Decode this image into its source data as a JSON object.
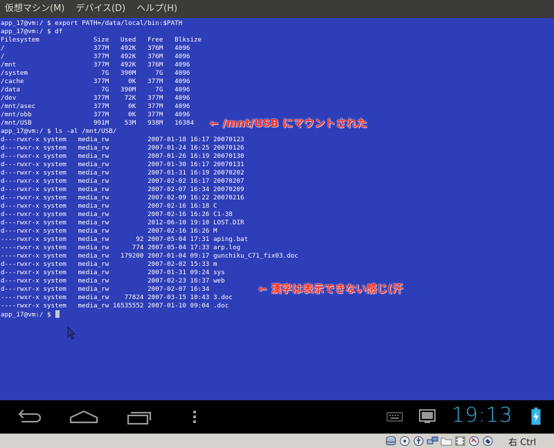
{
  "menubar": {
    "items": [
      "仮想マシン(M)",
      "デバイス(D)",
      "ヘルプ(H)"
    ]
  },
  "terminal": {
    "lines": [
      "app_17@vm:/ $ export PATH=/data/local/bin:$PATH",
      "app_17@vm:/ $ df",
      "Filesystem              Size   Used   Free   Blksize",
      "/                       377M   492K   376M   4096",
      "/                       377M   492K   376M   4096",
      "/mnt                    377M   492K   376M   4096",
      "/system                   7G   390M     7G   4096",
      "/cache                  377M     0K   377M   4096",
      "/data                     7G   390M     7G   4096",
      "/dev                    377M    72K   377M   4096",
      "/mnt/asec               377M     0K   377M   4096",
      "/mnt/obb                377M     0K   377M   4096",
      "/mnt/USB                991M    53M   938M   16384",
      "app_17@vm:/ $ ls -al /mnt/USB/",
      "d---rwxr-x system   media_rw          2007-01-18 16:17 20070123",
      "d---rwxr-x system   media_rw          2007-01-24 16:25 20070126",
      "d---rwxr-x system   media_rw          2007-01-26 16:19 20070130",
      "d---rwxr-x system   media_rw          2007-01-30 16:17 20070131",
      "d---rwxr-x system   media_rw          2007-01-31 16:19 20070202",
      "d---rwxr-x system   media_rw          2007-02-02 16:17 20070207",
      "d---rwxr-x system   media_rw          2007-02-07 16:34 20070209",
      "d---rwxr-x system   media_rw          2007-02-09 16:22 20070216",
      "d---rwxr-x system   media_rw          2007-02-16 16:18 C",
      "d---rwxr-x system   media_rw          2007-02-16 16:26 C1-38",
      "d---rwxr-x system   media_rw          2012-06-10 19:10 LOST.DIR",
      "d---rwxr-x system   media_rw          2007-02-16 16:26 M",
      "----rwxr-x system   media_rw       92 2007-05-04 17:31 aping.bat",
      "----rwxr-x system   media_rw      774 2007-05-04 17:33 arp.log",
      "----rwxr-x system   media_rw   179200 2007-01-04 09:17 gunchiku_C71_fix03.doc",
      "d---rwxr-x system   media_rw          2007-02-02 15:33 m",
      "d---rwxr-x system   media_rw          2007-01-31 09:24 sys",
      "d---rwxr-x system   media_rw          2007-02-23 16:37 web",
      "d---rwxr-x system   media_rw          2007-02-07 16:34",
      "----rwxr-x system   media_rw    77824 2007-03-15 10:43 3.doc",
      "----rwxr-x system   media_rw 16535552 2007-01-10 09:04 .doc"
    ],
    "prompt": "app_17@vm:/ $ "
  },
  "annotations": {
    "mount_note": "← /mnt/USB にマウントされた",
    "kanji_note": "← 漢字は表示できない感じ(汗"
  },
  "navbar": {
    "clock": "19:13"
  },
  "vbox_status": {
    "host_key": "右 Ctrl"
  },
  "colors": {
    "terminal_bg": "#2e3eb8",
    "annotation": "#ff2a1a",
    "clock": "#33b5e5"
  },
  "icons": {
    "navbar": [
      "back-icon",
      "home-icon",
      "recent-apps-icon",
      "menu-dots-icon",
      "keyboard-icon",
      "screenshot-icon",
      "battery-charging-icon"
    ],
    "vbox": [
      "hard-disk-icon",
      "optical-disk-icon",
      "usb-icon",
      "network-icon",
      "shared-folder-icon",
      "video-capture-icon",
      "mouse-integration-icon",
      "keyboard-capture-icon"
    ]
  }
}
